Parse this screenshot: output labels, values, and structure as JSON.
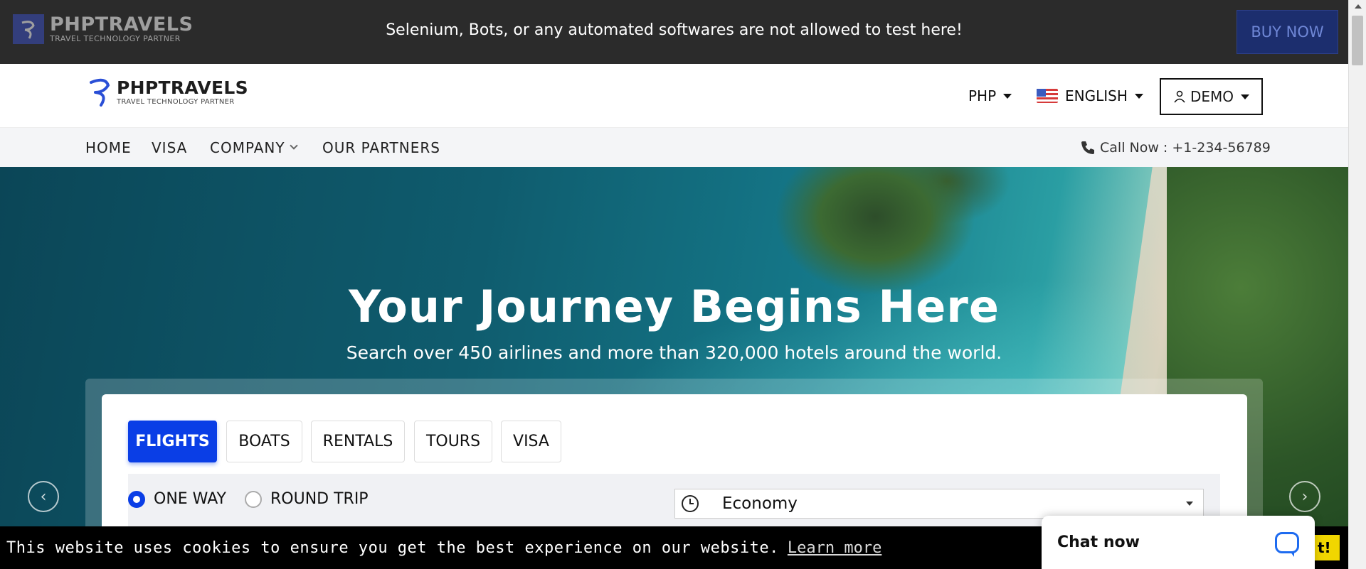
{
  "topbar": {
    "logo_brand": "PHPTRAVELS",
    "logo_tag": "TRAVEL TECHNOLOGY PARTNER",
    "message": "Selenium, Bots, or any automated softwares are not allowed to test here!",
    "buy_label": "BUY NOW"
  },
  "header": {
    "logo_brand": "PHPTRAVELS",
    "logo_tag": "TRAVEL TECHNOLOGY PARTNER",
    "currency": "PHP",
    "language": "ENGLISH",
    "account": "DEMO"
  },
  "nav": {
    "items": [
      "HOME",
      "VISA",
      "COMPANY",
      "OUR PARTNERS"
    ],
    "call": "Call Now : +1-234-56789"
  },
  "hero": {
    "title": "Your Journey Begins Here",
    "subtitle": "Search over 450 airlines and more than 320,000 hotels around the world."
  },
  "search": {
    "tabs": [
      "FLIGHTS",
      "BOATS",
      "RENTALS",
      "TOURS",
      "VISA"
    ],
    "active_tab": "FLIGHTS",
    "trip_types": [
      "ONE WAY",
      "ROUND TRIP"
    ],
    "selected_trip": "ONE WAY",
    "cabin_class": "Economy"
  },
  "cookie": {
    "message": "This website uses cookies to ensure you get the best experience on our website.",
    "learn_more": "Learn more",
    "button_visible": "t!"
  },
  "chat": {
    "label": "Chat now"
  },
  "colors": {
    "primary": "#0a3ee6",
    "topbar": "#2b2b2b",
    "cookie_button": "#f1d600"
  }
}
